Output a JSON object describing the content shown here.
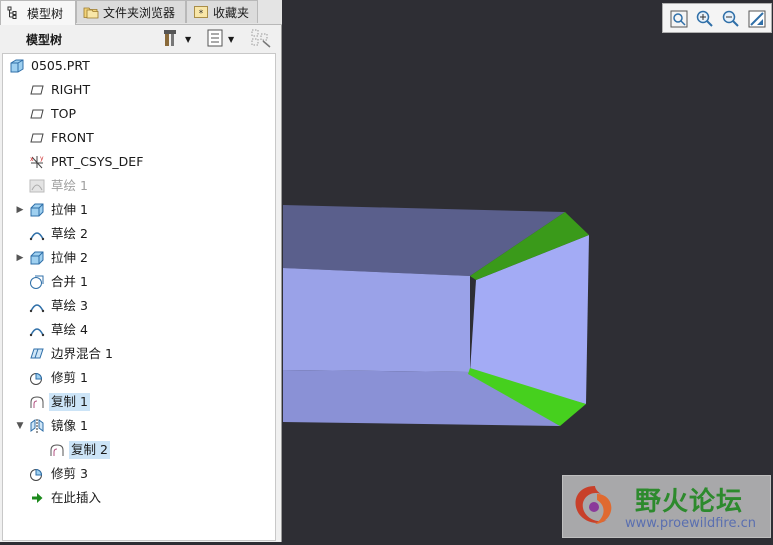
{
  "tabs": [
    {
      "label": "模型树",
      "icon": "model-tree-icon"
    },
    {
      "label": "文件夹浏览器",
      "icon": "folder-browser-icon"
    },
    {
      "label": "收藏夹",
      "icon": "favorites-icon"
    }
  ],
  "toolbar": {
    "title": "模型树"
  },
  "tree": {
    "root": "0505.PRT",
    "items": [
      {
        "label": "RIGHT",
        "icon": "datum-plane-icon"
      },
      {
        "label": "TOP",
        "icon": "datum-plane-icon"
      },
      {
        "label": "FRONT",
        "icon": "datum-plane-icon"
      },
      {
        "label": "PRT_CSYS_DEF",
        "icon": "csys-icon"
      },
      {
        "label": "草绘 1",
        "icon": "sketch-icon"
      },
      {
        "label": "拉伸 1",
        "icon": "extrude-icon"
      },
      {
        "label": "草绘 2",
        "icon": "sketch-icon"
      },
      {
        "label": "拉伸 2",
        "icon": "extrude-icon"
      },
      {
        "label": "合并 1",
        "icon": "merge-icon"
      },
      {
        "label": "草绘 3",
        "icon": "sketch-icon"
      },
      {
        "label": "草绘 4",
        "icon": "sketch-icon"
      },
      {
        "label": "边界混合 1",
        "icon": "boundary-blend-icon"
      },
      {
        "label": "修剪 1",
        "icon": "trim-icon"
      },
      {
        "label": "复制 1",
        "icon": "copy-icon"
      },
      {
        "label": "镜像 1",
        "icon": "mirror-icon"
      },
      {
        "label": "复制 2",
        "icon": "copy-icon"
      },
      {
        "label": "修剪 3",
        "icon": "trim-icon"
      },
      {
        "label": "在此插入",
        "icon": "insert-here-icon"
      }
    ]
  },
  "view_toolbar": {
    "buttons": [
      "refit-icon",
      "zoom-in-icon",
      "zoom-out-icon",
      "repaint-icon"
    ]
  },
  "watermark": {
    "title": "野火论坛",
    "url": "www.proewildfire.cn"
  },
  "colors": {
    "background": "#2e2e34",
    "surface": "#a3abf5",
    "highlight": "#44cc22",
    "selection": "#cce4f7"
  }
}
